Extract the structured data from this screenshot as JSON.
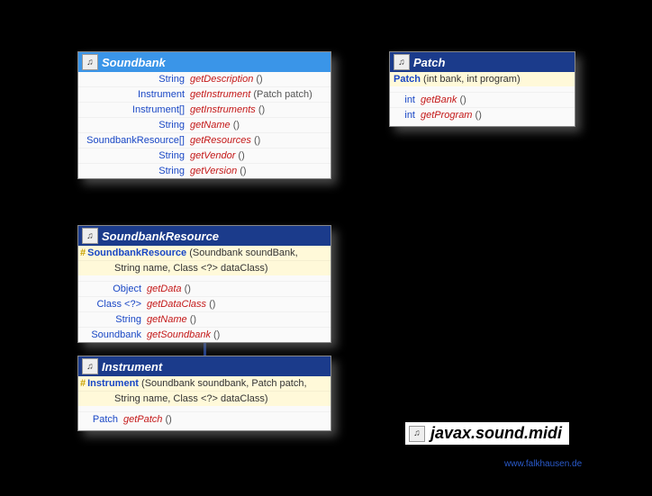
{
  "palette": {
    "light": "#3a95e8",
    "dark": "#1b3b8b",
    "type": "#1947c5",
    "name": "#c41818"
  },
  "soundbank": {
    "title": "Soundbank",
    "methods": [
      {
        "ret": "String",
        "name": "getDescription",
        "params": "()"
      },
      {
        "ret": "Instrument",
        "name": "getInstrument",
        "params": "(Patch patch)"
      },
      {
        "ret": "Instrument[]",
        "name": "getInstruments",
        "params": "()"
      },
      {
        "ret": "String",
        "name": "getName",
        "params": "()"
      },
      {
        "ret": "SoundbankResource[]",
        "name": "getResources",
        "params": "()"
      },
      {
        "ret": "String",
        "name": "getVendor",
        "params": "()"
      },
      {
        "ret": "String",
        "name": "getVersion",
        "params": "()"
      }
    ]
  },
  "patch": {
    "title": "Patch",
    "constructor": {
      "name": "Patch",
      "params": "(int bank, int program)"
    },
    "methods": [
      {
        "ret": "int",
        "name": "getBank",
        "params": "()"
      },
      {
        "ret": "int",
        "name": "getProgram",
        "params": "()"
      }
    ]
  },
  "sbres": {
    "title": "SoundbankResource",
    "constructor": {
      "prot": "#",
      "name": "SoundbankResource",
      "line1": "(Soundbank soundBank,",
      "line2": "String name, Class <?> dataClass)"
    },
    "methods": [
      {
        "ret": "Object",
        "name": "getData",
        "params": "()"
      },
      {
        "ret": "Class <?>",
        "name": "getDataClass",
        "params": "()"
      },
      {
        "ret": "String",
        "name": "getName",
        "params": "()"
      },
      {
        "ret": "Soundbank",
        "name": "getSoundbank",
        "params": "()"
      }
    ]
  },
  "instrument": {
    "title": "Instrument",
    "constructor": {
      "prot": "#",
      "name": "Instrument",
      "line1": "(Soundbank soundbank, Patch patch,",
      "line2": "String name, Class <?> dataClass)"
    },
    "methods": [
      {
        "ret": "Patch",
        "name": "getPatch",
        "params": "()"
      }
    ]
  },
  "package_label": "javax.sound.midi",
  "footer": "www.falkhausen.de",
  "icon_glyph": "♫"
}
